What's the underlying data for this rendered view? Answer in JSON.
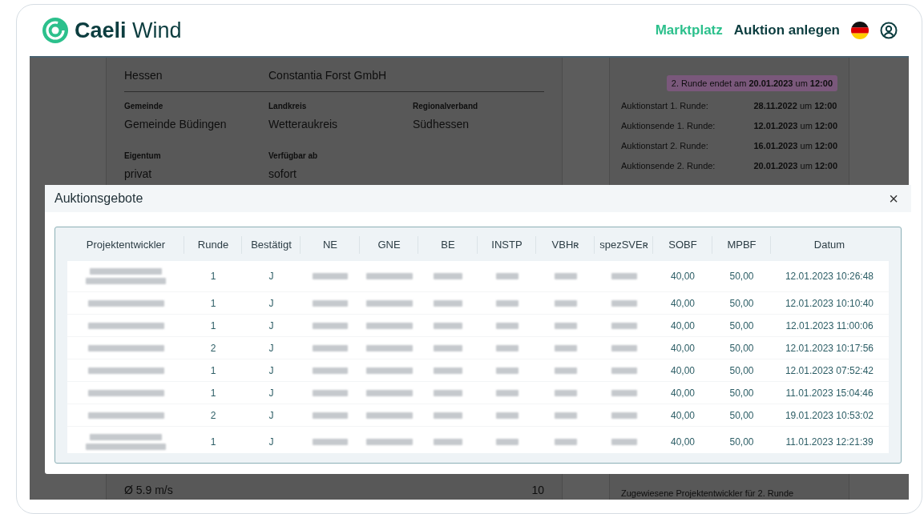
{
  "header": {
    "logo_bold": "Caeli",
    "logo_light": "Wind",
    "nav": [
      {
        "label": "Marktplatz",
        "selected": true
      },
      {
        "label": "Auktion anlegen",
        "selected": false
      }
    ]
  },
  "background": {
    "top_values": [
      "Hessen",
      "Constantia Forst GmbH"
    ],
    "field_rows": [
      [
        {
          "label": "Gemeinde",
          "value": "Gemeinde Büdingen"
        },
        {
          "label": "Landkreis",
          "value": "Wetteraukreis"
        },
        {
          "label": "Regionalverband",
          "value": "Südhessen"
        }
      ],
      [
        {
          "label": "Eigentum",
          "value": "privat"
        },
        {
          "label": "Verfügbar ab",
          "value": "sofort"
        }
      ]
    ],
    "bottom_values": [
      "Ø 5.9 m/s",
      "10"
    ],
    "round_badge": "2. Runde endet am **20.01.2023** um **12:00**",
    "schedule": [
      {
        "label": "Auktionstart 1. Runde:",
        "value": "**28.11.2022** um **12:00**"
      },
      {
        "label": "Auktionsende 1. Runde:",
        "value": "**12.01.2023** um **12:00**"
      },
      {
        "label": "Auktionstart 2. Runde:",
        "value": "**16.01.2023** um **12:00**"
      },
      {
        "label": "Auktionsende 2. Runde:",
        "value": "**20.01.2023** um **12:00**"
      }
    ],
    "assigned_title": "Zugewiesene Projektentwickler für 2. Runde"
  },
  "modal": {
    "title": "Auktionsgebote",
    "close": "×",
    "columns": [
      "Projektentwickler",
      "Runde",
      "Bestätigt",
      "NE",
      "GNE",
      "BE",
      "INSTP",
      "VBHʀ",
      "spezSVEʀ",
      "SOBF",
      "MPBF",
      "Datum"
    ],
    "rows": [
      {
        "kind": "tall",
        "runde": "1",
        "bestaetigt": "J",
        "sobf": "40,00",
        "mpbf": "50,00",
        "datum": "12.01.2023 10:26:48"
      },
      {
        "kind": "short",
        "runde": "1",
        "bestaetigt": "J",
        "sobf": "40,00",
        "mpbf": "50,00",
        "datum": "12.01.2023 10:10:40"
      },
      {
        "kind": "short",
        "runde": "1",
        "bestaetigt": "J",
        "sobf": "40,00",
        "mpbf": "50,00",
        "datum": "12.01.2023 11:00:06"
      },
      {
        "kind": "short",
        "runde": "2",
        "bestaetigt": "J",
        "sobf": "40,00",
        "mpbf": "50,00",
        "datum": "12.01.2023 10:17:56"
      },
      {
        "kind": "short",
        "runde": "1",
        "bestaetigt": "J",
        "sobf": "40,00",
        "mpbf": "50,00",
        "datum": "12.01.2023 07:52:42"
      },
      {
        "kind": "short",
        "runde": "1",
        "bestaetigt": "J",
        "sobf": "40,00",
        "mpbf": "50,00",
        "datum": "11.01.2023 15:04:46"
      },
      {
        "kind": "short",
        "runde": "2",
        "bestaetigt": "J",
        "sobf": "40,00",
        "mpbf": "50,00",
        "datum": "19.01.2023 10:53:02"
      },
      {
        "kind": "tall",
        "runde": "1",
        "bestaetigt": "J",
        "sobf": "40,00",
        "mpbf": "50,00",
        "datum": "11.01.2023 12:21:39"
      }
    ]
  }
}
